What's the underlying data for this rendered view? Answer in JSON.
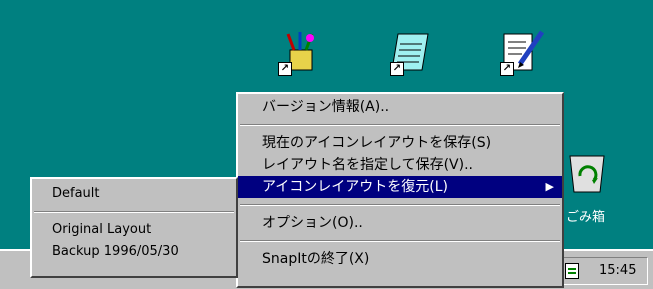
{
  "desktop": {
    "icons": [
      {
        "name": "paint-icon"
      },
      {
        "name": "notepad-icon"
      },
      {
        "name": "write-icon"
      }
    ],
    "recycle_bin_label": "ごみ箱"
  },
  "context_menu": {
    "items": [
      "バージョン情報(A)..",
      "現在のアイコンレイアウトを保存(S)",
      "レイアウト名を指定して保存(V)..",
      "アイコンレイアウトを復元(L)",
      "オプション(O)..",
      "SnapItの終了(X)"
    ],
    "submenu_arrow": "▶"
  },
  "submenu": {
    "items": [
      "Default",
      "Original Layout",
      "Backup 1996/05/30"
    ]
  },
  "taskbar": {
    "clock": "15:45"
  }
}
